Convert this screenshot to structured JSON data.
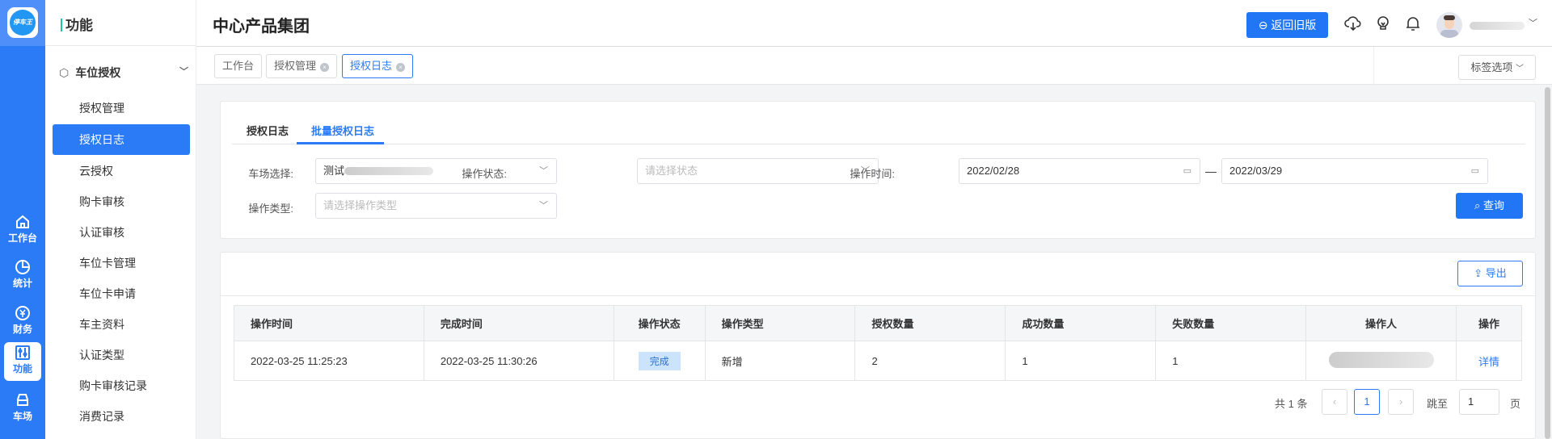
{
  "app": {
    "logo_text": "停车王"
  },
  "rail": [
    {
      "label": "工作台",
      "icon": "home-icon"
    },
    {
      "label": "统计",
      "icon": "pie-chart-icon"
    },
    {
      "label": "财务",
      "icon": "yen-icon"
    },
    {
      "label": "功能",
      "icon": "sliders-icon",
      "active": true
    },
    {
      "label": "车场",
      "icon": "car-icon"
    }
  ],
  "sidebar": {
    "title": "功能",
    "group": "车位授权",
    "items": [
      "授权管理",
      "授权日志",
      "云授权",
      "购卡审核",
      "认证审核",
      "车位卡管理",
      "车位卡申请",
      "车主资料",
      "认证类型",
      "购卡审核记录",
      "消费记录"
    ],
    "active_index": 1
  },
  "header": {
    "title": "中心产品集团",
    "back_button": "返回旧版"
  },
  "tabs": {
    "items": [
      {
        "label": "工作台"
      },
      {
        "label": "授权管理"
      },
      {
        "label": "授权日志",
        "active": true
      }
    ],
    "options": "标签选项"
  },
  "filter": {
    "tabs": [
      "授权日志",
      "批量授权日志"
    ],
    "active_tab": 1,
    "lot_label": "车场选择:",
    "lot_value": "测试",
    "status_label": "操作状态:",
    "status_placeholder": "请选择状态",
    "time_label": "操作时间:",
    "date_from": "2022/02/28",
    "date_sep": "—",
    "date_to": "2022/03/29",
    "type_label": "操作类型:",
    "type_placeholder": "请选择操作类型",
    "query_button": "查询"
  },
  "export_button": "导出",
  "table": {
    "columns": [
      "操作时间",
      "完成时间",
      "操作状态",
      "操作类型",
      "授权数量",
      "成功数量",
      "失败数量",
      "操作人",
      "操作"
    ],
    "rows": [
      {
        "op_time": "2022-03-25 11:25:23",
        "done_time": "2022-03-25 11:30:26",
        "status": "完成",
        "type": "新增",
        "count": "2",
        "success": "1",
        "fail": "1",
        "action": "详情"
      }
    ]
  },
  "pagination": {
    "total": "共 1 条",
    "current": "1",
    "jump_label": "跳至",
    "jump_value": "1",
    "page_suffix": "页"
  },
  "colors": {
    "primary": "#2176f5",
    "rail": "#2b7bf7"
  }
}
